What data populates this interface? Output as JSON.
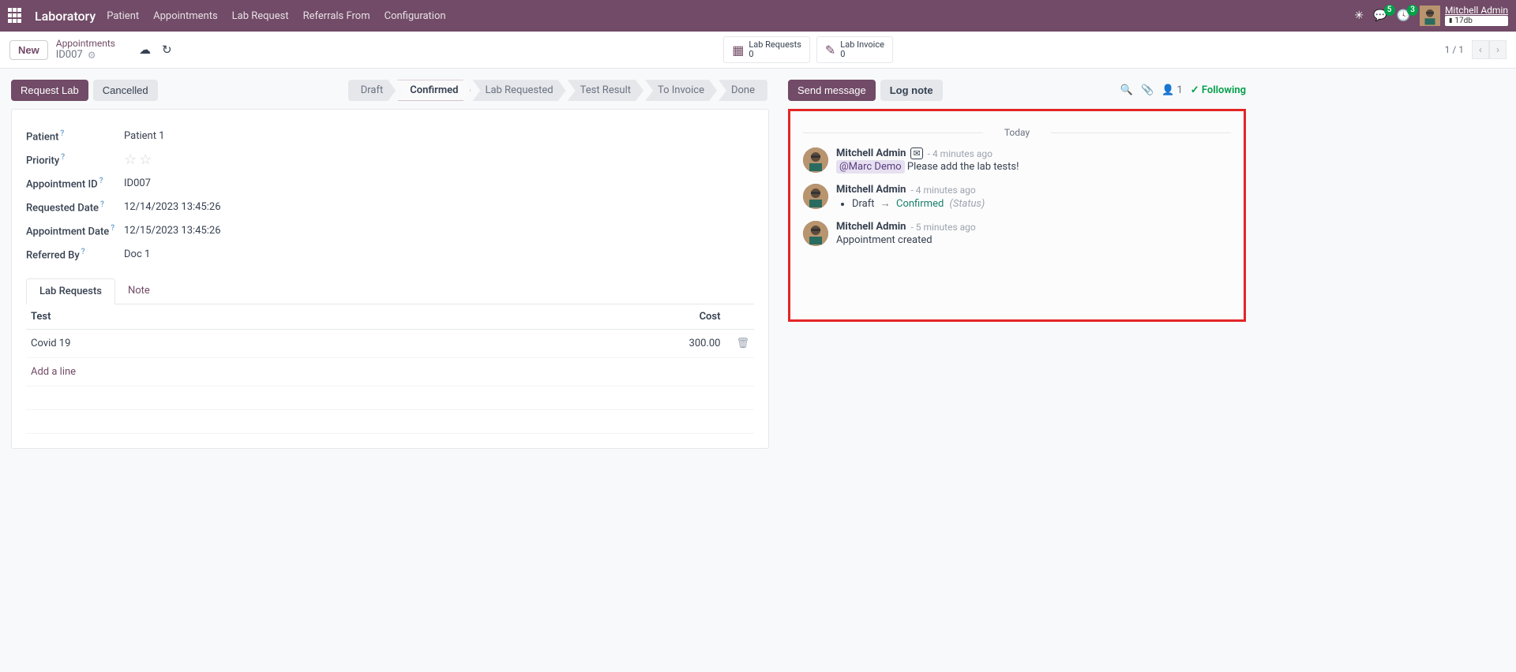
{
  "navbar": {
    "brand": "Laboratory",
    "menu": [
      "Patient",
      "Appointments",
      "Lab Request",
      "Referrals From",
      "Configuration"
    ],
    "chat_badge": "5",
    "activity_badge": "3",
    "user_name": "Mitchell Admin",
    "db_name": "17db"
  },
  "cp": {
    "new_btn": "New",
    "breadcrumb_parent": "Appointments",
    "record_id": "ID007",
    "stat1_label": "Lab Requests",
    "stat1_count": "0",
    "stat2_label": "Lab Invoice",
    "stat2_count": "0",
    "pager": "1 / 1"
  },
  "actions": {
    "request_lab": "Request Lab",
    "cancelled": "Cancelled"
  },
  "statusbar": [
    "Draft",
    "Confirmed",
    "Lab Requested",
    "Test Result",
    "To Invoice",
    "Done"
  ],
  "fields": {
    "patient_label": "Patient",
    "patient_value": "Patient 1",
    "priority_label": "Priority",
    "appointment_id_label": "Appointment ID",
    "appointment_id_value": "ID007",
    "requested_date_label": "Requested Date",
    "requested_date_value": "12/14/2023 13:45:26",
    "appointment_date_label": "Appointment Date",
    "appointment_date_value": "12/15/2023 13:45:26",
    "referred_by_label": "Referred By",
    "referred_by_value": "Doc 1"
  },
  "tabs": {
    "lab_requests": "Lab Requests",
    "note": "Note"
  },
  "table": {
    "col_test": "Test",
    "col_cost": "Cost",
    "row1_test": "Covid 19",
    "row1_cost": "300.00",
    "add_line": "Add a line"
  },
  "chatter": {
    "send_message": "Send message",
    "log_note": "Log note",
    "follower_count": "1",
    "following": "Following",
    "today": "Today",
    "msg1_author": "Mitchell Admin",
    "msg1_time": "- 4 minutes ago",
    "msg1_mention": "@Marc Demo",
    "msg1_text": " Please add the lab tests!",
    "msg2_author": "Mitchell Admin",
    "msg2_time": "- 4 minutes ago",
    "msg2_old": "Draft",
    "msg2_new": "Confirmed",
    "msg2_field": "(Status)",
    "msg3_author": "Mitchell Admin",
    "msg3_time": "- 5 minutes ago",
    "msg3_text": "Appointment created"
  }
}
